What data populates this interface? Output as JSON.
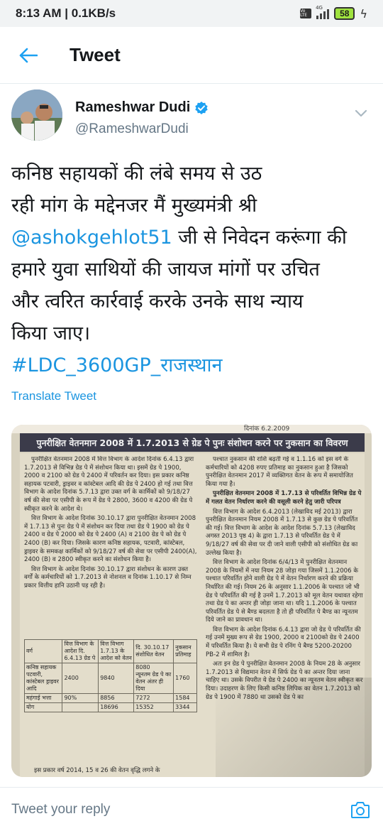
{
  "status_bar": {
    "time_network": "8:13 AM | 0.1KB/s",
    "volte": "Vo LTE",
    "network_type": "4G",
    "battery": "58"
  },
  "header": {
    "title": "Tweet"
  },
  "author": {
    "display_name": "Rameshwar Dudi",
    "handle": "@RameshwarDudi",
    "verified": true
  },
  "tweet": {
    "line1": "कनिष्ठ सहायकों की लंबे समय से उठ",
    "line2": "रही मांग के मद्देनजर मैं मुख्यमंत्री श्री",
    "mention": "@ashokgehlot51",
    "line3_rest": " जी से निवेदन करूंगा की",
    "line4": "हमारे युवा साथियों की जायज मांगों पर उचित",
    "line5": "और त्वरित कार्रवाई करके उनके साथ न्याय",
    "line6": "किया जाए।",
    "hashtag": "#LDC_3600GP_राजस्थान"
  },
  "translate_label": "Translate Tweet",
  "news": {
    "top_strip": "दिनांक 6.2.2009",
    "banner": "पुनरीक्षित वेतनमान 2008 में 1.7.2013 से ग्रेड पे पुनः संशोधन करने पर नुकसान का विवरण",
    "left_p1": "पुनरीक्षित वेतनमान 2008 में वित्त विभाग के आदेश दिनांक 6.4.13 द्वारा 1.7.2013 से विभिन्न ग्रेड पे में संशोधन किया था। इसमें ग्रेड पे 1900, 2000 व 2100 को ग्रेड पे 2400 में परिवर्तन कर दिया। इस प्रकार कनिष्ठ सहायक पटवारी, ड्राइवर व कांस्टेबल आदि की ग्रेड पे 2400 हो गई तथा वित्त विभाग के आदेश दिनांक 5.7.13 द्वारा उक्त वर्ग के कार्मिकों को 9/18/27 वर्ष की सेवा पर एसीपी के रूप में ग्रेड पे 2800, 3600 व 4200 की ग्रेड पे स्वीकृत करने के आदेश थे।",
    "left_p2": "वित्त विभाग के आदेश दिनांक 30.10.17 द्वारा पुनरीक्षित वेतनमान 2008 में 1.7.13 से पुनः ग्रेड पे में संशोधन कर दिया तथा ग्रेड पे 1900 को ग्रेड पे 2400 व ग्रेड पे 2000 को ग्रेड पे 2400 (A) व 2100 ग्रेड पे को ग्रेड पे 2400 (B) कर दिया। जिसके कारण कनिष्ठ सहायक, पटवारी, कांस्टेबल, ड्राइवर के समकक्ष कार्मिकों को 9/18/27 वर्ष की सेवा पर एसीपी 2400(A), 2400 (B) व 2800 स्वीकृत करने का संशोधन किया है।",
    "left_p3": "वित्त विभाग के आदेश दिनांक 30.10.17 द्वारा संशोधन के कारण उक्त वर्गों के कर्मचारियों को 1.7.2013 से नोशनल व दिनांक 1.10.17 से निम्न प्रकार वित्तीय हानि उठानी पड़ रही है।",
    "table": {
      "h1": "वर्ग",
      "h2": "वित्त विभाग के आदेश दि. 6.4.13 ग्रेड पे",
      "h3": "वित्त विभाग 1.7.13 के आदेश को वेतन",
      "h4": "दि. 30.10.17 संशोधित वेतन",
      "h5": "नुकसान प्रतिमाह",
      "r1c1": "कनिष्ठ सहायक पटवारी, कांस्टेबल ड्राइवर आदि",
      "r1c2": "2400",
      "r1c3": "9840",
      "r1c4": "8080",
      "r1c5": "1760",
      "r1c6": "न्यूनतम ग्रेड पे का वेतन अंतर ही दिया",
      "r2c1": "महंगाई भत्ता",
      "r2c2": "90%",
      "r2c3": "8856",
      "r2c4": "7272",
      "r2c5": "1584",
      "r3c1": "योग",
      "r3c3": "18696",
      "r3c4": "15352",
      "r3c5": "3344"
    },
    "left_footer": "इस प्रकार वर्ष 2014, 15 व 26 की वेतन वृद्धि लगने के",
    "right_p1": "पश्चात नुकसान की राशि बढ़ती गई व 1.1.16 को इस वर्ग के कर्मचारियों को 4208 रुपए प्रतिमाह का नुकसान हुआ है जिसको पुनरीक्षित वेतनमान 2017 में व्यक्तिगत वेतन के रूप में समायोजित किया गया है।",
    "right_sub": "पुनरीक्षित वेतनमान 2008 में 1.7.13 से परिवर्तित विभिन्न ग्रेड पे में गलत वेतन निर्धारण करने की वसूली करने हेतु जारी परिपत्र",
    "right_p2": "वित्त विभाग के आदेश 6.4.2013 (लेखाविद मई 2013) द्वारा पुनरीक्षित वेतनमान नियम 2008 में 1.7.13 से कुछ ग्रेड पे परिवर्तित की गई। वित्त विभाग के आदेश के आदेश दिनांक 5.7.13 (लेखाविद अगस्त 2013 पृष्ठ 4) के द्वारा 1.7.13 से परिवर्तित ग्रेड पे में 9/18/27 वर्ष की सेवा पर दी जाने वाली एसीपी को संशोधित ग्रेड का उल्लेख किया है।",
    "right_p3": "वित्त विभाग के आदेश दिनांक 6/4/13 में पुनरीक्षित वेतनमान 2008 के नियमों में नया नियम 28 जोड़ा गया जिसमें 1.1.2006 के पश्चात परिवर्तित होने वाली ग्रेड पे में वेतन निर्धारण करने की प्रक्रिया निर्धारित की गई। नियम 26 के अनुसार 1.1.2006 के पश्चात जो भी ग्रेड पे परिवर्तित की गई है उनमें 1.7.2013 को मूल वेतन यथावत रहेगा तथा ग्रेड पे का अन्तर ही जोड़ा जाना था। यदि 1.1.2006 के पश्चात परिवर्तित ग्रेड पे से बैण्ड बदलता है तो ही परिवर्तित पे बैण्ड का न्यूनतम दिये जाने का प्रावधान था।",
    "right_p4": "वित्त विभाग के आदेश दिनांक 6.4.13 द्वारा जो ग्रेड पे परिवर्तित की गई उनमें मुख्य रूप से ग्रेड 1900, 2000 व 2100को ग्रेड पे 2400 में परिवर्तित किया है। ये सभी ग्रेड पे रनिंग पे बैण्ड 5200-20200 PB-2 में शामिल है।",
    "right_p5": "अतः इन ग्रेड पे पुनरीक्षित वेतनमान 2008 के नियम 28 के अनुसार 1.7.2013 से विद्यमान वेतन में सिर्फ ग्रेड पे का अन्तर दिया जाना चाहिए था। उसके विपरीत ये ग्रेड पे 2400 का न्यूनतम वेतन स्वीकृत कर दिया। उदाहरण के लिए किसी कनिष्ठ लिपिक का वेतन 1.7.2013 को ग्रेड पे 1900 में 7880 था उसको ग्रेड पे का"
  },
  "reply": {
    "placeholder": "Tweet your reply"
  },
  "colors": {
    "accent": "#1b95e0",
    "text": "#14171a",
    "secondary": "#657786"
  }
}
